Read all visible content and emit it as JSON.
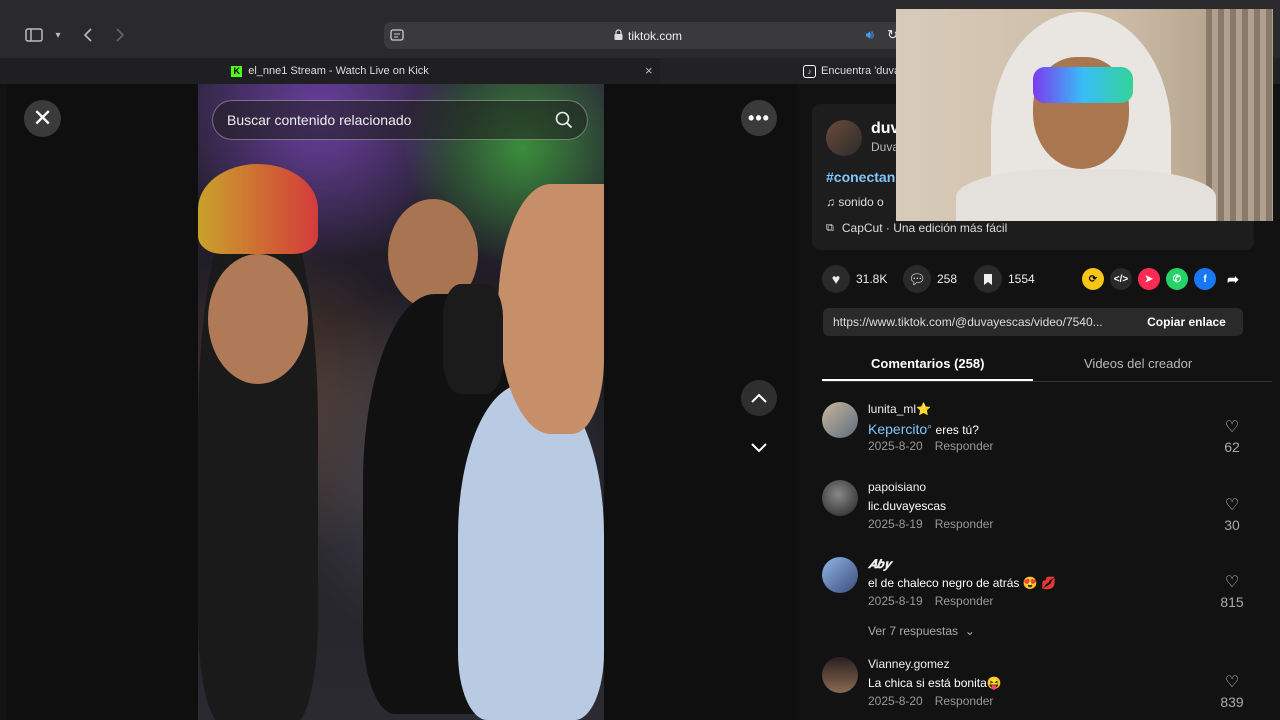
{
  "browser": {
    "url": "tiktok.com",
    "tabs": [
      {
        "title": "el_nne1 Stream - Watch Live on Kick"
      },
      {
        "title": "Encuentra 'duva"
      }
    ]
  },
  "player": {
    "search_placeholder": "Buscar contenido relacionado"
  },
  "creator": {
    "name": "duv",
    "sub": "Duva",
    "hashtag": "#conectan",
    "sound": "sonido o",
    "capcut": "CapCut · Una edición más fácil"
  },
  "actions": {
    "likes": "31.8K",
    "comments": "258",
    "saves": "1554"
  },
  "share": {
    "link": "https://www.tiktok.com/@duvayescas/video/7540...",
    "copy_label": "Copiar enlace"
  },
  "tabs": {
    "comments": "Comentarios (258)",
    "creator_videos": "Videos del creador"
  },
  "comments": [
    {
      "user": "lunita_ml⭐",
      "mention": "Kepercito",
      "text": " eres tú?",
      "date": "2025-8-20",
      "reply": "Responder",
      "likes": "62"
    },
    {
      "user": "papoisiano",
      "text": "lic.duvayescas",
      "date": "2025-8-19",
      "reply": "Responder",
      "likes": "30"
    },
    {
      "user": "𝑨𝒃𝒚",
      "text": "el de chaleco negro de atrás 😍 💋",
      "date": "2025-8-19",
      "reply": "Responder",
      "likes": "815",
      "more_replies": "Ver 7 respuestas"
    },
    {
      "user": "Vianney.gomez",
      "text": "La chica si está bonita😝",
      "date": "2025-8-20",
      "reply": "Responder",
      "likes": "839"
    }
  ],
  "colors": {
    "accent_link": "#7ec7ff",
    "kick_green": "#53fc18"
  }
}
